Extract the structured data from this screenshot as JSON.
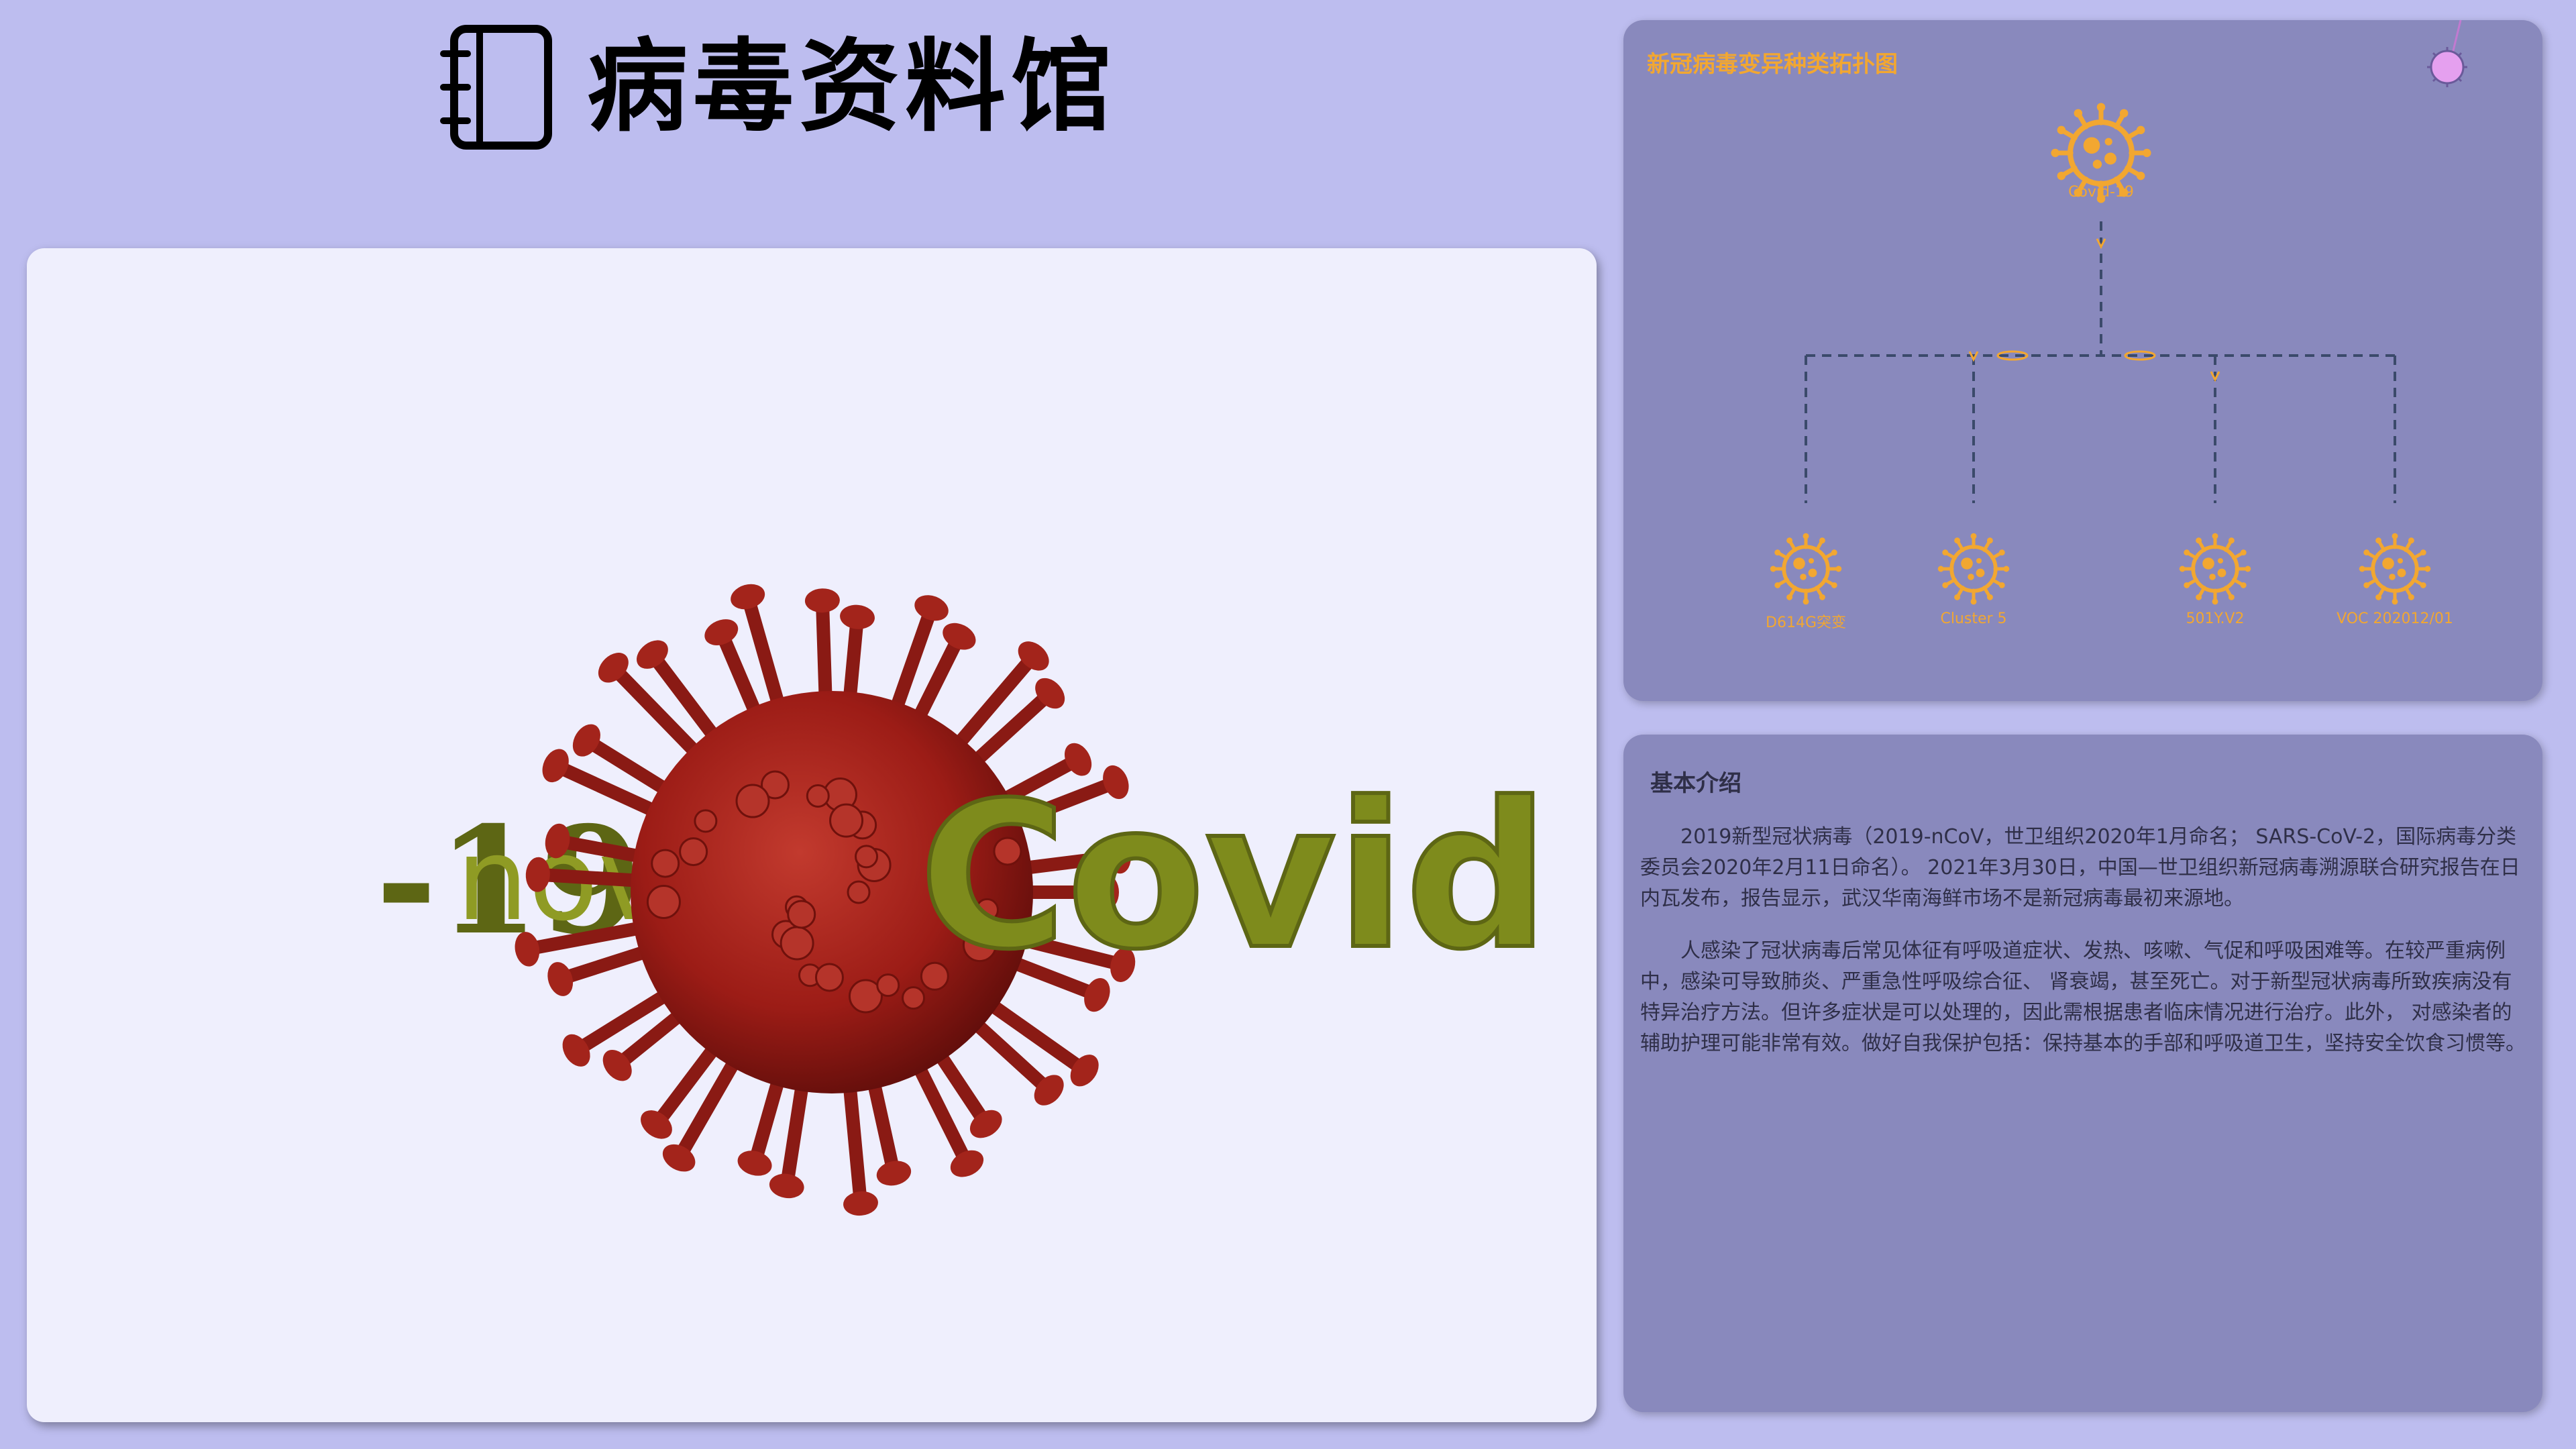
{
  "header": {
    "title": "病毒资料馆"
  },
  "viewer": {
    "text_left": "-19",
    "text_mid": "nove",
    "text_right": "Covid"
  },
  "topology": {
    "title": "新冠病毒变异种类拓扑图",
    "root_label": "Covid-19",
    "variants": [
      "D614G突变",
      "Cluster 5",
      "501Y.V2",
      "VOC 202012/01"
    ],
    "accent_color": "#f2a731",
    "line_color": "#3b4a6b"
  },
  "intro": {
    "title": "基本介绍",
    "paragraphs": [
      "2019新型冠状病毒（2019-nCoV，世卫组织2020年1月命名； SARS-CoV-2，国际病毒分类委员会2020年2月11日命名）。 2021年3月30日，中国—世卫组织新冠病毒溯源联合研究报告在日内瓦发布，报告显示，武汉华南海鲜市场不是新冠病毒最初来源地。",
      "人感染了冠状病毒后常见体征有呼吸道症状、发热、咳嗽、气促和呼吸困难等。在较严重病例中，感染可导致肺炎、严重急性呼吸综合征、 肾衰竭，甚至死亡。对于新型冠状病毒所致疾病没有特异治疗方法。但许多症状是可以处理的，因此需根据患者临床情况进行治疗。此外， 对感染者的辅助护理可能非常有效。做好自我保护包括：保持基本的手部和呼吸道卫生，坚持安全饮食习惯等。"
    ]
  },
  "colors": {
    "background": "#bdbdef",
    "panel": "#8989bd",
    "viewer_bg": "#efeffd",
    "virus_red": "#9c1c16",
    "text_green": "#7e8b1c"
  }
}
